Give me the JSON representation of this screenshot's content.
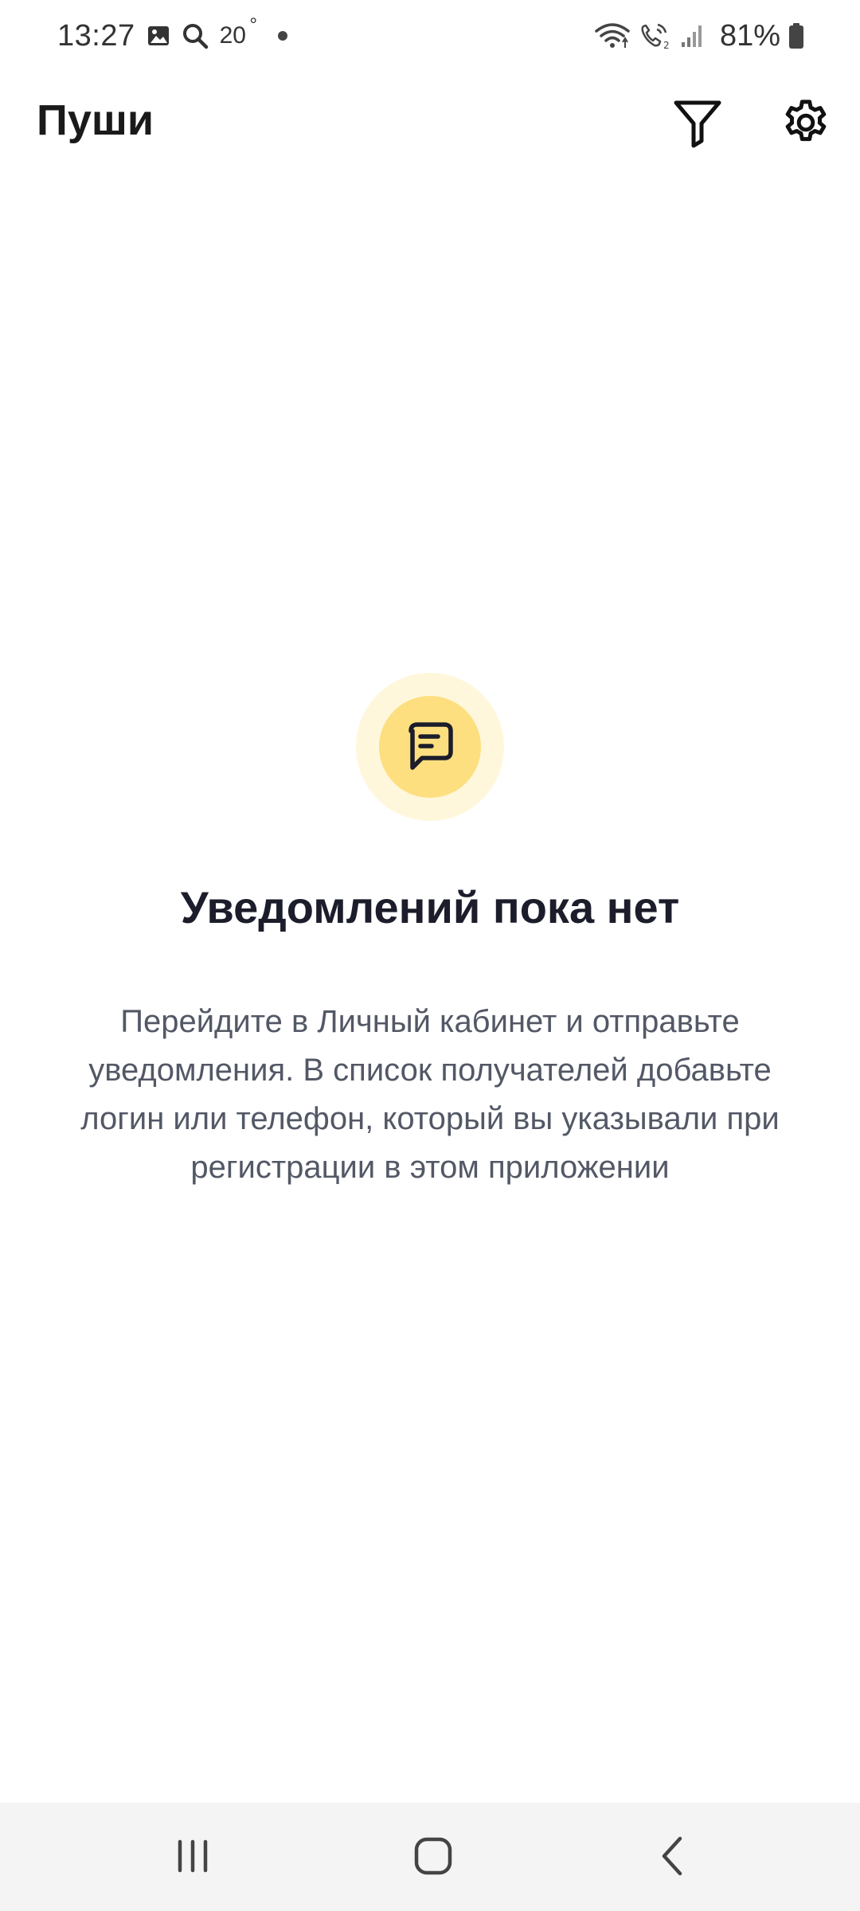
{
  "status_bar": {
    "time": "13:27",
    "temperature": "20",
    "battery": "81%",
    "icons": [
      "gallery-icon",
      "search-icon",
      "wifi-icon",
      "volte-call-icon",
      "signal-icon",
      "battery-icon"
    ]
  },
  "header": {
    "title": "Пуши",
    "actions": [
      "filter-icon",
      "settings-gear-icon"
    ]
  },
  "empty_state": {
    "icon": "chat-message-icon",
    "title": "Уведомлений пока нет",
    "description": "Перейдите в Личный кабинет и отправьте уведомления. В список получателей добавьте логин или телефон, который вы указывали при регистрации в этом приложении"
  },
  "colors": {
    "icon_outer": "#fff7dc",
    "icon_inner": "#fddf7f",
    "title": "#1b1d2b",
    "description": "#535866",
    "nav_background": "#f4f4f4"
  },
  "nav_bar": {
    "buttons": [
      "recent-apps-icon",
      "home-icon",
      "back-icon"
    ]
  }
}
